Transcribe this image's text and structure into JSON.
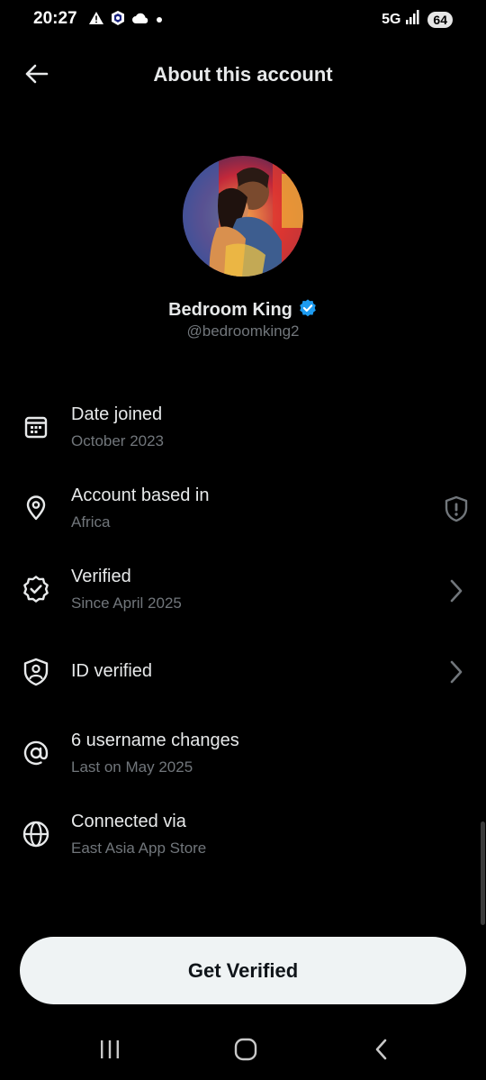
{
  "status_bar": {
    "time": "20:27",
    "network": "5G",
    "battery": "64",
    "icons": [
      "warning-icon",
      "app-shield-icon",
      "cloud-icon",
      "dot-icon",
      "signal-icon"
    ]
  },
  "header": {
    "title": "About this account",
    "back_icon": "arrow-left-icon"
  },
  "profile": {
    "display_name": "Bedroom King",
    "handle": "@bedroomking2",
    "verified_badge_color": "#1d9bf0",
    "avatar_icon": "profile-photo"
  },
  "rows": [
    {
      "icon": "calendar-icon",
      "title": "Date joined",
      "subtitle": "October 2023",
      "trailing": ""
    },
    {
      "icon": "location-pin-icon",
      "title": "Account based in",
      "subtitle": "Africa",
      "trailing": "shield-alert-icon"
    },
    {
      "icon": "verified-badge-icon",
      "title": "Verified",
      "subtitle": "Since April 2025",
      "trailing": "chevron-right-icon"
    },
    {
      "icon": "id-shield-icon",
      "title": "ID verified",
      "subtitle": "",
      "trailing": "chevron-right-icon"
    },
    {
      "icon": "at-sign-icon",
      "title": "6 username changes",
      "subtitle": "Last on May 2025",
      "trailing": ""
    },
    {
      "icon": "globe-icon",
      "title": "Connected via",
      "subtitle": "East Asia App Store",
      "trailing": ""
    }
  ],
  "cta": {
    "label": "Get Verified"
  },
  "nav_bar": {
    "icons": [
      "recent-apps-icon",
      "home-icon",
      "back-nav-icon"
    ]
  },
  "colors": {
    "background": "#000000",
    "primary_text": "#e7e9ea",
    "secondary_text": "#71767b",
    "accent": "#1d9bf0",
    "button_bg": "#eff3f4"
  }
}
